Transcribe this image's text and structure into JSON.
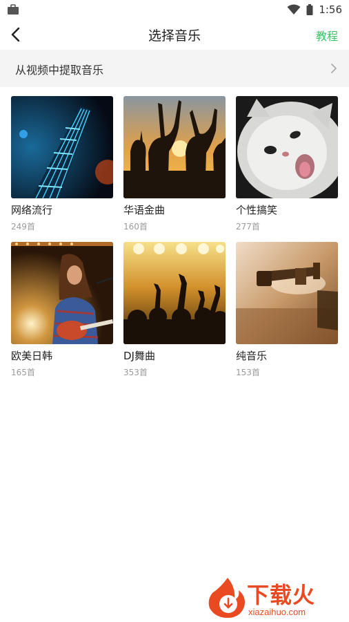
{
  "status_bar": {
    "time": "1:56"
  },
  "header": {
    "title": "选择音乐",
    "tutorial_label": "教程"
  },
  "extract_row": {
    "label": "从视频中提取音乐"
  },
  "categories": [
    {
      "name": "网络流行",
      "count": "249首"
    },
    {
      "name": "华语金曲",
      "count": "160首"
    },
    {
      "name": "个性搞笑",
      "count": "277首"
    },
    {
      "name": "欧美日韩",
      "count": "165首"
    },
    {
      "name": "DJ舞曲",
      "count": "353首"
    },
    {
      "name": "纯音乐",
      "count": "153首"
    }
  ],
  "watermark": {
    "brand": "下载火",
    "url": "xiazaihuo.com"
  },
  "colors": {
    "accent_green": "#37c463",
    "watermark_orange": "#ea4a22",
    "row_bg": "#f4f4f4"
  }
}
